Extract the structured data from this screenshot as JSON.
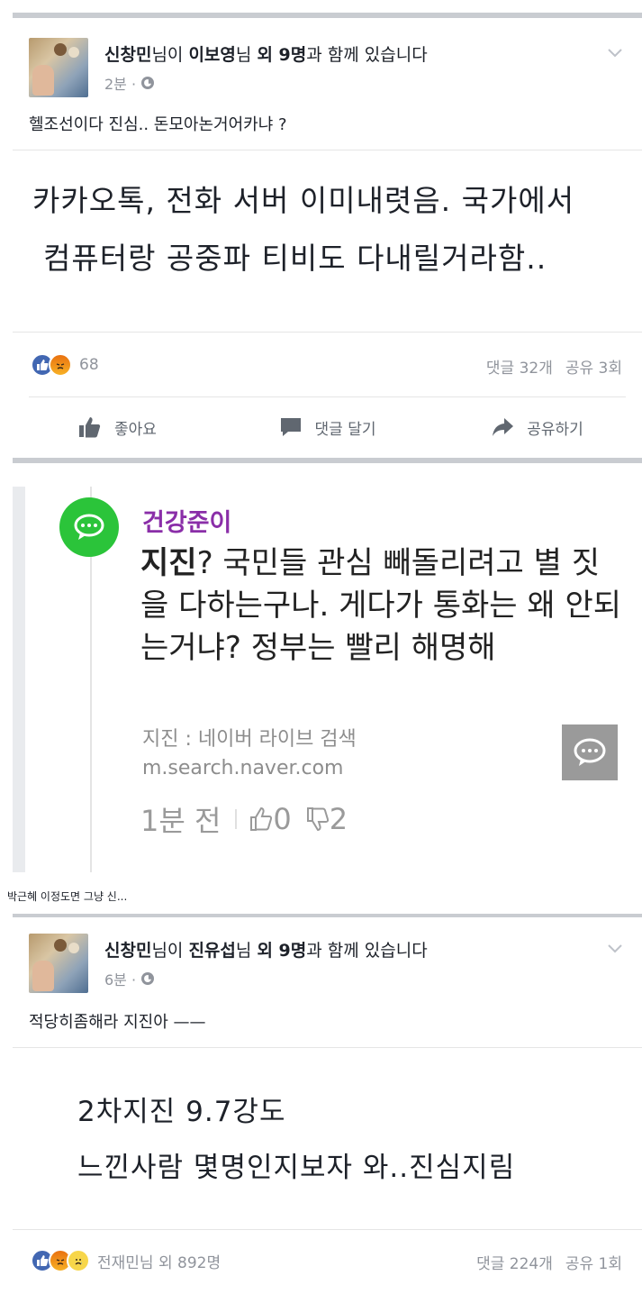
{
  "post1": {
    "author": "신창민",
    "author_suffix": "님이 ",
    "tagged": "이보영",
    "tagged_suffix": "님 ",
    "others": "외 9명",
    "others_suffix": "과 함께 있습니다",
    "time": "2분 ·",
    "caption": "헬조선이다 진심.. 돈모아논거어카냐 ?",
    "body_line1": "카카오톡, 전화 서버 이미내렷음. 국가에서",
    "body_line2": "컴퓨터랑 공중파 티비도 다내릴거라함..",
    "reaction_count": "68",
    "comments": "댓글 32개",
    "shares": "공유 3회",
    "actions": {
      "like": "좋아요",
      "comment": "댓글 달기",
      "share": "공유하기"
    }
  },
  "embed": {
    "name": "건강준이",
    "body_bold": "지진",
    "body_rest": "? 국민들 관심 빼돌리려고 별 짓을 다하는구나. 게다가 통화는 왜 안되는거냐? 정부는 빨리 해명해",
    "source": "지진 : 네이버 라이브 검색",
    "url": "m.search.naver.com",
    "time": "1분 전",
    "likes": "0",
    "dislikes": "2"
  },
  "between_caption": "박근혜 이정도면 그냥 신...",
  "post2": {
    "author": "신창민",
    "author_suffix": "님이 ",
    "tagged": "진유섭",
    "tagged_suffix": "님 ",
    "others": "외 9명",
    "others_suffix": "과 함께 있습니다",
    "time": "6분 ·",
    "caption": "적당히좀해라 지진아 ——",
    "body_line1": "2차지진 9.7강도",
    "body_line2": "느낀사람 몇명인지보자 와..진심지림",
    "reaction_text": "전재민님 외 892명",
    "comments": "댓글 224개",
    "shares": "공유 1회"
  },
  "colors": {
    "facebook_blue": "#4267b2",
    "angry_orange": "#e9710f",
    "embed_green": "#2bc43a",
    "embed_name_purple": "#8a2ea8"
  }
}
